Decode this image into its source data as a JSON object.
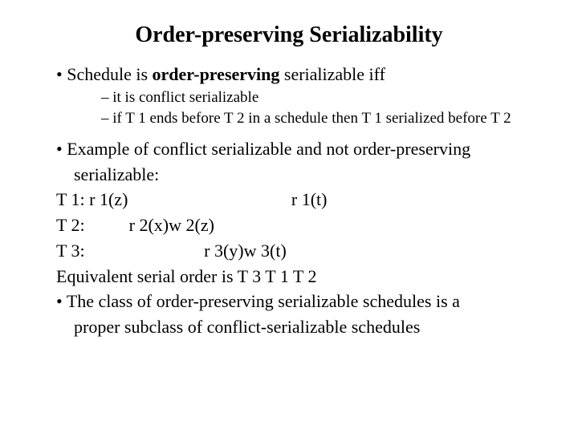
{
  "title": "Order-preserving Serializability",
  "b1_a_pre": "Schedule is ",
  "b1_a_bold": "order-preserving ",
  "b1_a_post": "serializable iff",
  "b2_a": "it is conflict serializable",
  "b2_b": "if T 1 ends before T 2 in a schedule then T 1 serialized before T 2",
  "b1_b_l1": "Example of conflict serializable and not order-preserving",
  "b1_b_l2": "serializable:",
  "sched_t1": "T 1: r 1(z)                                     r 1(t)",
  "sched_t2": "T 2:          r 2(x)w 2(z)",
  "sched_t3": "T 3:                           r 3(y)w 3(t)",
  "equiv": "Equivalent serial order is T 3 T 1 T 2",
  "b1_c_l1": "The class of order-preserving serializable schedules is a",
  "b1_c_l2": "proper subclass of conflict-serializable schedules"
}
